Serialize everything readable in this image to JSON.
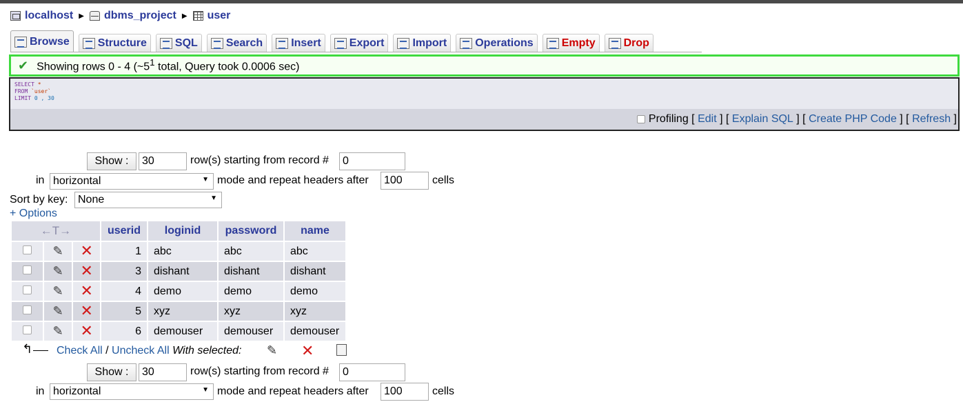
{
  "breadcrumb": {
    "server": "localhost",
    "database": "dbms_project",
    "table": "user"
  },
  "tabs": [
    {
      "label": "Browse",
      "icon": "browse-icon"
    },
    {
      "label": "Structure",
      "icon": "structure-icon"
    },
    {
      "label": "SQL",
      "icon": "sql-icon"
    },
    {
      "label": "Search",
      "icon": "search-icon"
    },
    {
      "label": "Insert",
      "icon": "insert-icon"
    },
    {
      "label": "Export",
      "icon": "export-icon"
    },
    {
      "label": "Import",
      "icon": "import-icon"
    },
    {
      "label": "Operations",
      "icon": "operations-icon"
    },
    {
      "label": "Empty",
      "icon": "empty-icon"
    },
    {
      "label": "Drop",
      "icon": "drop-icon"
    }
  ],
  "status": {
    "prefix": "Showing rows 0 - 4 (~5",
    "sup": "1",
    "suffix": " total, Query took 0.0006 sec)"
  },
  "sql": {
    "kw_select": "SELECT",
    "star": " *",
    "kw_from": "FROM",
    "table": " `user`",
    "kw_limit": "LIMIT",
    "limit_vals": " 0 , 30"
  },
  "sql_links": {
    "profiling": "Profiling",
    "edit": "Edit",
    "explain": "Explain SQL",
    "php": "Create PHP Code",
    "refresh": "Refresh"
  },
  "nav": {
    "show_label": "Show :",
    "rows_value": "30",
    "starting_text": "row(s) starting from record #",
    "start_value": "0",
    "in_text": "in",
    "mode_value": "horizontal",
    "mode_text": "mode and repeat headers after",
    "repeat_value": "100",
    "cells_text": "cells"
  },
  "sort": {
    "label": "Sort by key:",
    "value": "None"
  },
  "options_link": "+ Options",
  "table": {
    "headers": [
      "userid",
      "loginid",
      "password",
      "name"
    ],
    "arrows": "←T→",
    "rows": [
      [
        "1",
        "abc",
        "abc",
        "abc"
      ],
      [
        "3",
        "dishant",
        "dishant",
        "dishant"
      ],
      [
        "4",
        "demo",
        "demo",
        "demo"
      ],
      [
        "5",
        "xyz",
        "xyz",
        "xyz"
      ],
      [
        "6",
        "demouser",
        "demouser",
        "demouser"
      ]
    ]
  },
  "bulk": {
    "check_all": "Check All",
    "slash": " / ",
    "uncheck_all": "Uncheck All",
    "with_selected": "With selected:"
  },
  "colors": {
    "link": "#235a9f",
    "header_text": "#2b3a9a",
    "success_border": "#3fda3f",
    "danger": "#cc0000"
  }
}
